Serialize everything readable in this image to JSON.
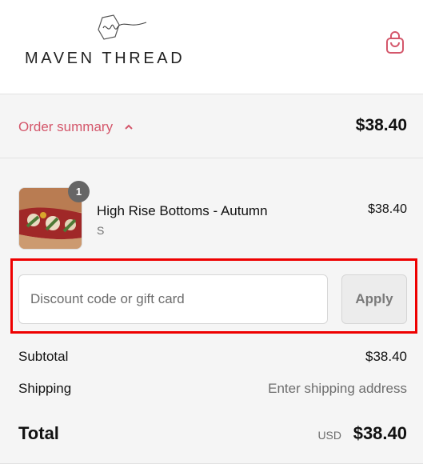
{
  "brand": {
    "name": "MAVEN THREAD"
  },
  "header": {
    "cart_icon": "shopping-bag-icon"
  },
  "summary": {
    "toggle_label": "Order summary",
    "toggle_icon": "chevron-up-icon",
    "total": "$38.40",
    "accent_color": "#d4576b"
  },
  "line_items": [
    {
      "quantity": "1",
      "title": "High Rise Bottoms - Autumn",
      "variant": "S",
      "price": "$38.40"
    }
  ],
  "discount": {
    "placeholder": "Discount code or gift card",
    "value": "",
    "apply_label": "Apply",
    "highlight_color": "#ee0000"
  },
  "costs": {
    "subtotal_label": "Subtotal",
    "subtotal_value": "$38.40",
    "shipping_label": "Shipping",
    "shipping_value": "Enter shipping address",
    "total_label": "Total",
    "total_currency": "USD",
    "total_value": "$38.40"
  }
}
